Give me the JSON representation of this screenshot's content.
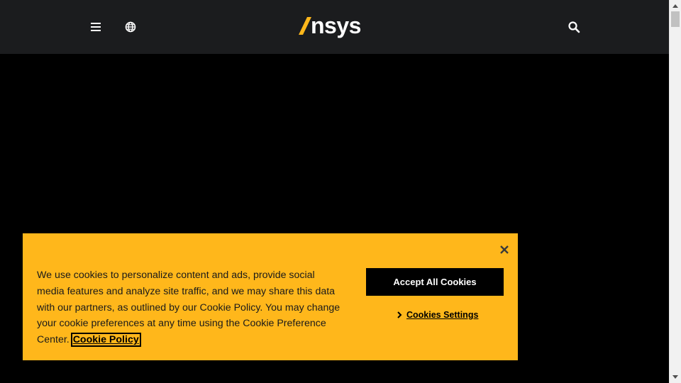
{
  "header": {
    "logo_text": "nsys",
    "logo_accent_color": "#ffb71b",
    "background_color": "#1b1c1e",
    "menu_icon": "hamburger-menu-icon",
    "globe_icon": "globe-icon",
    "search_icon": "search-icon"
  },
  "cookie_banner": {
    "background_color": "#ffb71b",
    "message": "We use cookies to personalize content and ads, provide social media features and analyze site traffic, and we may share this data with our partners, as outlined by our Cookie Policy. You may change your cookie preferences at any time using the Cookie Preference Center. ",
    "policy_link_label": "Cookie Policy",
    "accept_button_label": "Accept All Cookies",
    "settings_link_label": "Cookies Settings",
    "close_icon": "close-icon"
  }
}
